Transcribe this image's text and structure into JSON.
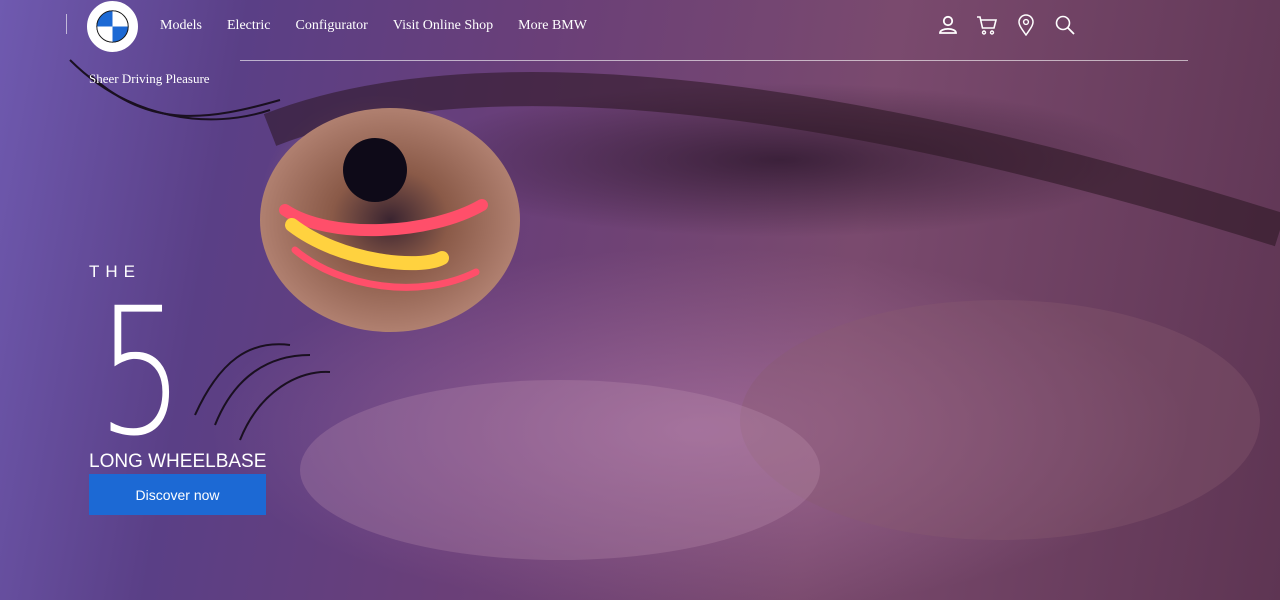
{
  "brand": {
    "logo": "bmw-roundel-logo"
  },
  "nav": {
    "links": [
      "Models",
      "Electric",
      "Configurator",
      "Visit Online Shop",
      "More BMW"
    ],
    "icons": [
      "user-icon",
      "cart-icon",
      "location-pin-icon",
      "search-icon"
    ],
    "tagline": "Sheer Driving Pleasure"
  },
  "hero": {
    "background": "close-up-eye-with-taillight-reflection",
    "prefix": "THE",
    "model": "5",
    "variant": "LONG WHEELBASE",
    "cta_label": "Discover now"
  },
  "colors": {
    "cta": "#1c69d4",
    "text": "#ffffff",
    "logo_blue": "#1c69d4"
  }
}
